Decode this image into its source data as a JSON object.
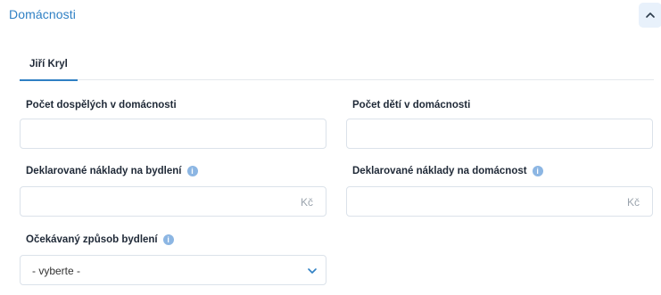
{
  "section": {
    "title": "Domácnosti",
    "collapse_icon": "chevron-up-icon"
  },
  "tabs": [
    {
      "label": "Jiří Kryl",
      "active": true
    }
  ],
  "fields": {
    "adults": {
      "label": "Počet dospělých v domácnosti",
      "value": ""
    },
    "children": {
      "label": "Počet dětí v domácnosti",
      "value": ""
    },
    "housing_costs": {
      "label": "Deklarované náklady na bydlení",
      "value": "",
      "suffix": "Kč",
      "info_icon": "info-icon"
    },
    "household_costs": {
      "label": "Deklarované náklady na domácnost",
      "value": "",
      "suffix": "Kč",
      "info_icon": "info-icon"
    },
    "housing_type": {
      "label": "Očekávaný způsob bydlení",
      "selected": "- vyberte -",
      "info_icon": "info-icon"
    }
  },
  "colors": {
    "accent": "#2f80c4",
    "info_icon": "#8cb6e3",
    "border": "#dbe2ea"
  }
}
